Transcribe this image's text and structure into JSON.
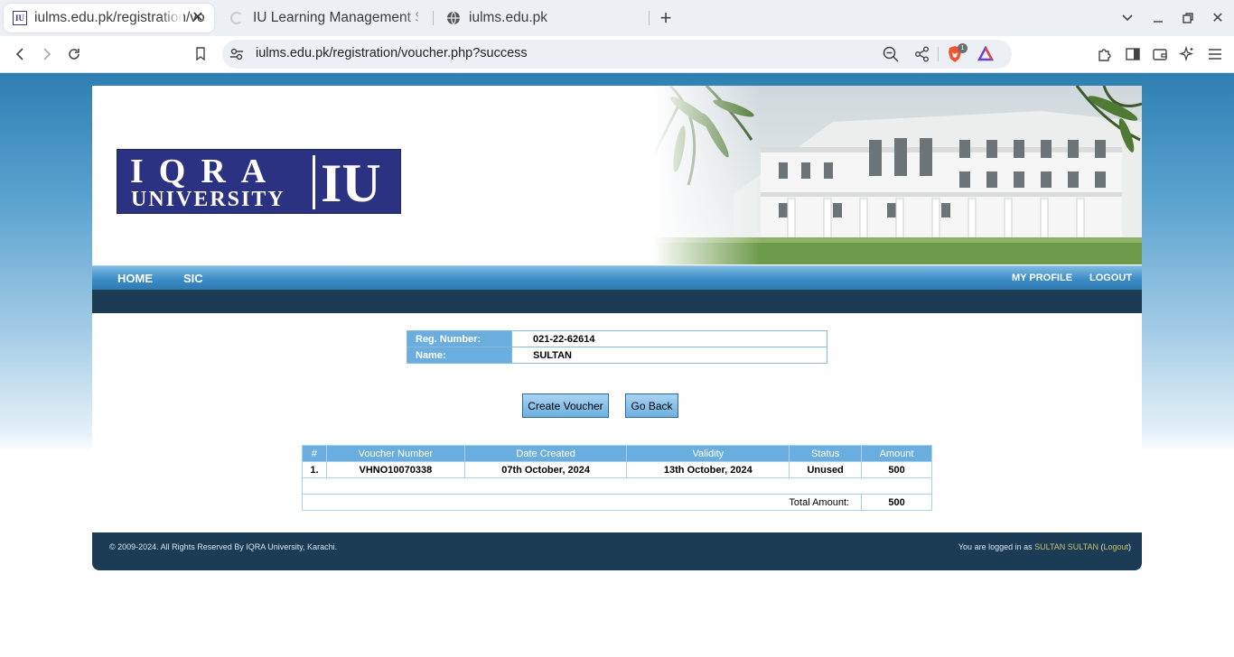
{
  "browser": {
    "tabs": [
      {
        "title": "iulms.edu.pk/registration/voucher.php?success",
        "active": true
      },
      {
        "title": "IU Learning Management System",
        "active": false,
        "loading": true
      },
      {
        "title": "iulms.edu.pk",
        "active": false
      }
    ],
    "url": "iulms.edu.pk/registration/voucher.php?success",
    "brave_badge": "1"
  },
  "logo": {
    "line1": "IQRA",
    "line2": "UNIVERSITY",
    "mark": "IU"
  },
  "nav": {
    "left": [
      "HOME",
      "SIC"
    ],
    "right": [
      "MY PROFILE",
      "LOGOUT"
    ]
  },
  "student": {
    "reg_label": "Reg. Number:",
    "reg_value": "021-22-62614",
    "name_label": "Name:",
    "name_value": "SULTAN"
  },
  "buttons": {
    "create": "Create Voucher",
    "back": "Go Back"
  },
  "vouchers": {
    "headers": [
      "#",
      "Voucher Number",
      "Date Created",
      "Validity",
      "Status",
      "Amount"
    ],
    "rows": [
      [
        "1.",
        "VHNO10070338",
        "07th October, 2024",
        "13th October, 2024",
        "Unused",
        "500"
      ]
    ],
    "total_label": "Total Amount:",
    "total_value": "500"
  },
  "footer": {
    "copyright": "© 2009-2024. All Rights Reserved By IQRA University, Karachi.",
    "logged_prefix": "You are logged in as ",
    "user": "SULTAN SULTAN",
    "open_paren": " (",
    "logout": "Logout",
    "close_paren": ")"
  },
  "colors": {
    "nav_blue": "#3b8cc6",
    "dark_band": "#1c3c55",
    "header_cell": "#6aaee0",
    "logo_blue": "#2b3282",
    "footer_user": "#c9c46b"
  }
}
